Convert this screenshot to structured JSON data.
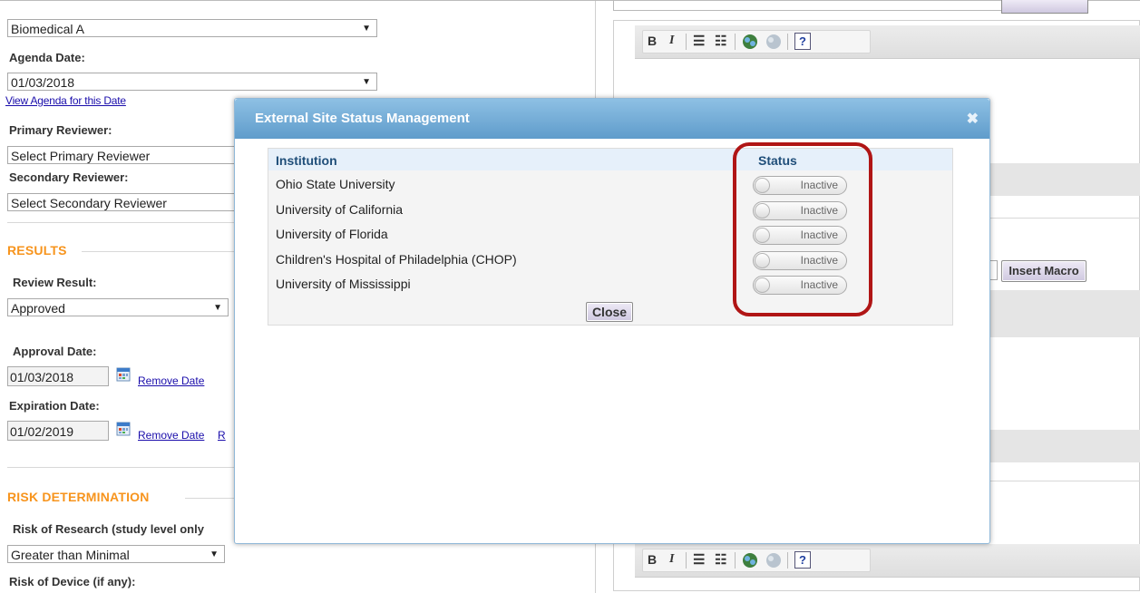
{
  "left_form": {
    "committee_value": "Biomedical A",
    "agenda_date_label": "Agenda Date:",
    "agenda_date_value": "01/03/2018",
    "view_agenda_link": "View Agenda for this Date",
    "primary_reviewer_label": "Primary Reviewer:",
    "primary_reviewer_value": "Select Primary Reviewer",
    "secondary_reviewer_label": "Secondary Reviewer:",
    "secondary_reviewer_value": "Select Secondary Reviewer",
    "results_heading": "RESULTS",
    "review_result_label": "Review Result:",
    "review_result_value": "Approved",
    "approval_date_label": "Approval Date:",
    "approval_date_value": "01/03/2018",
    "remove_date_link": "Remove Date",
    "expiration_date_label": "Expiration Date:",
    "expiration_date_value": "01/02/2019",
    "remove_date_link_2": "Remove Date",
    "extra_link_fragment": "R",
    "risk_heading": "RISK DETERMINATION",
    "risk_of_research_label": "Risk of Research (study level only",
    "risk_of_research_value": "Greater than Minimal",
    "risk_of_device_label": "Risk of Device (if any):"
  },
  "right_editor": {
    "toolbar": {
      "bold": "B",
      "italic": "I",
      "help": "?"
    },
    "insert_macro_label": "Insert Macro"
  },
  "modal": {
    "title": "External Site Status Management",
    "close_icon_glyph": "✖",
    "columns": {
      "institution": "Institution",
      "status": "Status"
    },
    "rows": [
      {
        "institution": "Ohio State University",
        "status": "Inactive"
      },
      {
        "institution": "University of California",
        "status": "Inactive"
      },
      {
        "institution": "University of Florida",
        "status": "Inactive"
      },
      {
        "institution": "Children's Hospital of Philadelphia (CHOP)",
        "status": "Inactive"
      },
      {
        "institution": "University of Mississippi",
        "status": "Inactive"
      }
    ],
    "close_button": "Close"
  },
  "colors": {
    "section_heading": "#f7941d",
    "modal_header": "#5f9ccb",
    "highlight_ring": "#b01515",
    "link": "#1a0dab"
  }
}
